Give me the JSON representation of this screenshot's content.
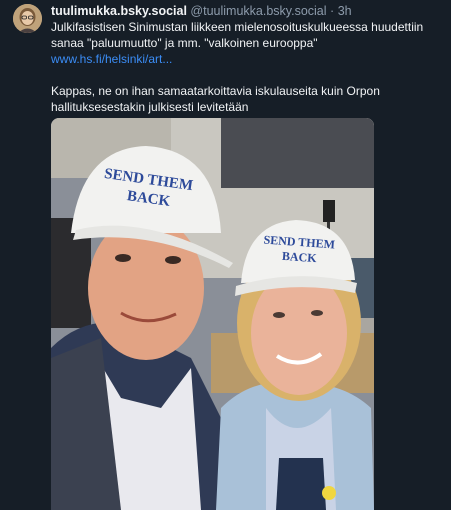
{
  "post": {
    "author": {
      "display_name": "tuulimukka.bsky.social",
      "handle": "@tuulimukka.bsky.social",
      "separator": "·",
      "time": "3h"
    },
    "text": {
      "line1": "Julkifasistisen Sinimustan liikkeen mielenosoituskulkueessa  huudettiin",
      "line2": "sanaa \"paluumuutto\" ja mm. \"valkoinen eurooppa\"",
      "link": "www.hs.fi/helsinki/art...",
      "line3": "Kappas, ne on ihan samaatarkoittavia iskulauseita kuin Orpon",
      "line4": "hallituksesestakin julkisesti levitetään"
    },
    "image": {
      "left_cap_text": [
        "SEND THEM",
        "BACK"
      ],
      "right_cap_text": [
        "SEND THEM",
        "BACK"
      ]
    }
  }
}
